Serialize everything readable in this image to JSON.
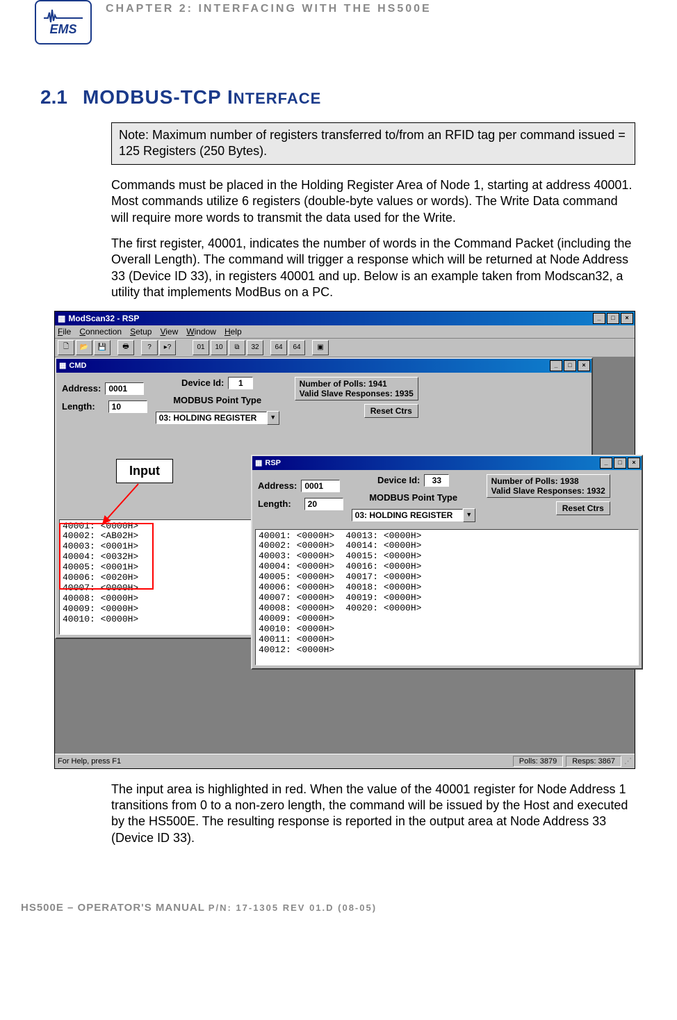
{
  "logo_text": "EMS",
  "chapter_title": "CHAPTER 2: INTERFACING WITH THE HS500E",
  "section_num": "2.1",
  "section_title_main": "MODBUS-TCP I",
  "section_title_small": "NTERFACE",
  "note_text": "Note: Maximum number of registers transferred to/from an RFID tag per command issued = 125 Registers (250 Bytes).",
  "para1": "Commands must be placed in the Holding Register Area of Node 1, starting at address 40001. Most commands utilize 6 registers (double-byte values or words). The Write Data command will require more words to transmit the data used for the Write.",
  "para2": "The first register, 40001, indicates the number of words in the Command Packet (including the Overall Length). The command will trigger a response which will be returned at Node Address 33 (Device ID 33), in registers 40001 and up. Below is an example taken from Modscan32, a utility that implements ModBus on a PC.",
  "para3": "The input area is highlighted in red. When the value of the 40001 register for Node Address 1 transitions from 0 to a non-zero length, the command will be issued by the Host and executed by the HS500E. The resulting response is reported in the output area at Node Address 33 (Device ID 33).",
  "footer_main": "HS500E – OPERATOR'S MANUAL ",
  "footer_small": "P/N: 17-1305 REV 01.D (08-05)",
  "app": {
    "title": "ModScan32 - RSP",
    "menu": [
      "File",
      "Connection",
      "Setup",
      "View",
      "Window",
      "Help"
    ],
    "status_help": "For Help, press F1",
    "status_polls": "Polls: 3879",
    "status_resps": "Resps: 3867"
  },
  "labels": {
    "address": "Address:",
    "length": "Length:",
    "device_id": "Device Id:",
    "point_type": "MODBUS Point Type",
    "polls_prefix": "Number of Polls: ",
    "valid_prefix": "Valid Slave Responses: ",
    "reset": "Reset Ctrs",
    "input_callout": "Input"
  },
  "cmd": {
    "title": "CMD",
    "address": "0001",
    "length": "10",
    "device_id": "1",
    "point_type": "03: HOLDING REGISTER",
    "polls": "1941",
    "valid": "1935",
    "registers": [
      "40001: <0000H>",
      "40002: <AB02H>",
      "40003: <0001H>",
      "40004: <0032H>",
      "40005: <0001H>",
      "40006: <0020H>",
      "40007: <0000H>",
      "40008: <0000H>",
      "40009: <0000H>",
      "40010: <0000H>"
    ]
  },
  "rsp": {
    "title": "RSP",
    "address": "0001",
    "length": "20",
    "device_id": "33",
    "point_type": "03: HOLDING REGISTER",
    "polls": "1938",
    "valid": "1932",
    "registers_col1": [
      "40001: <0000H>",
      "40002: <0000H>",
      "40003: <0000H>",
      "40004: <0000H>",
      "40005: <0000H>",
      "40006: <0000H>",
      "40007: <0000H>",
      "40008: <0000H>",
      "40009: <0000H>",
      "40010: <0000H>",
      "40011: <0000H>",
      "40012: <0000H>"
    ],
    "registers_col2": [
      "40013: <0000H>",
      "40014: <0000H>",
      "40015: <0000H>",
      "40016: <0000H>",
      "40017: <0000H>",
      "40018: <0000H>",
      "40019: <0000H>",
      "40020: <0000H>"
    ]
  }
}
